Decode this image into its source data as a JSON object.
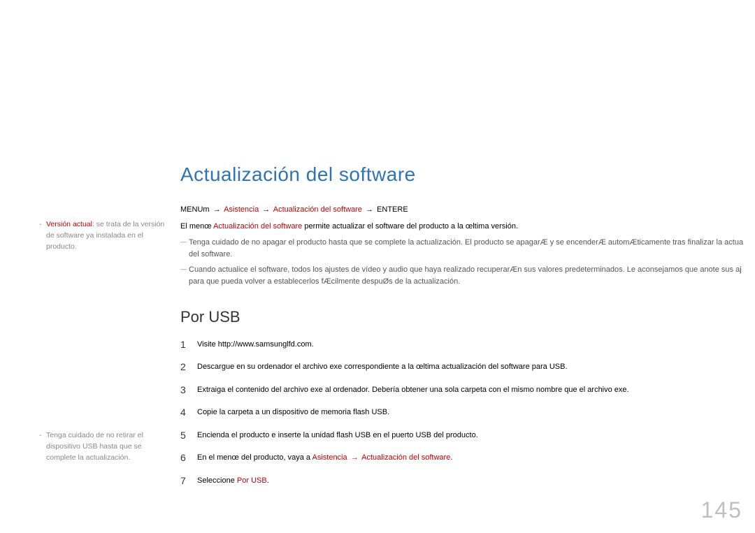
{
  "title": "Actualización del software",
  "breadcrumb": {
    "prefix": "MENUm",
    "arrow": "→",
    "part1": "Asistencia",
    "part2": "Actualización del software",
    "suffix": "ENTERE"
  },
  "desc_prefix": "El menœ",
  "desc_red": "Actualización del software",
  "desc_suffix": "permite actualizar el software del producto a la œltima versión.",
  "note1_line1": "Tenga cuidado de no apagar el producto hasta que se complete la actualización. El producto se apagarÆ y se encenderÆ automÆticamente tras finalizar la actua",
  "note1_line2": "del software.",
  "note2_line1": "Cuando actualice el software, todos los ajustes de vídeo y audio que haya realizado recuperarÆn sus valores predeterminados. Le aconsejamos que anote sus aj",
  "note2_line2": "para que pueda volver a establecerlos fÆcilmente despuØs de la actualización.",
  "subheading": "Por USB",
  "steps": {
    "s1": "Visite http://www.samsunglfd.com.",
    "s2": "Descargue en su ordenador el archivo exe correspondiente a la œltima actualización del software para USB.",
    "s3": "Extraiga el contenido del archivo exe al ordenador. Debería obtener una sola carpeta con el mismo nombre que el archivo exe.",
    "s4": "Copie la carpeta a un dispositivo de memoria flash USB.",
    "s5": "Encienda el producto e inserte la unidad flash USB en el puerto USB del producto.",
    "s6_prefix": "En el menœ del producto, vaya a",
    "s6_red1": "Asistencia",
    "s6_arrow": "→",
    "s6_red2": "Actualización del software",
    "s6_suffix": ".",
    "s7_prefix": "Seleccione",
    "s7_red": "Por USB",
    "s7_suffix": "."
  },
  "sidenote1": {
    "red": "Versión actual",
    "rest": ": se trata de la versión de software ya instalada en el producto."
  },
  "sidenote2": "Tenga cuidado de no retirar el dispositivo USB hasta que se complete la actualización.",
  "page_number": "145"
}
